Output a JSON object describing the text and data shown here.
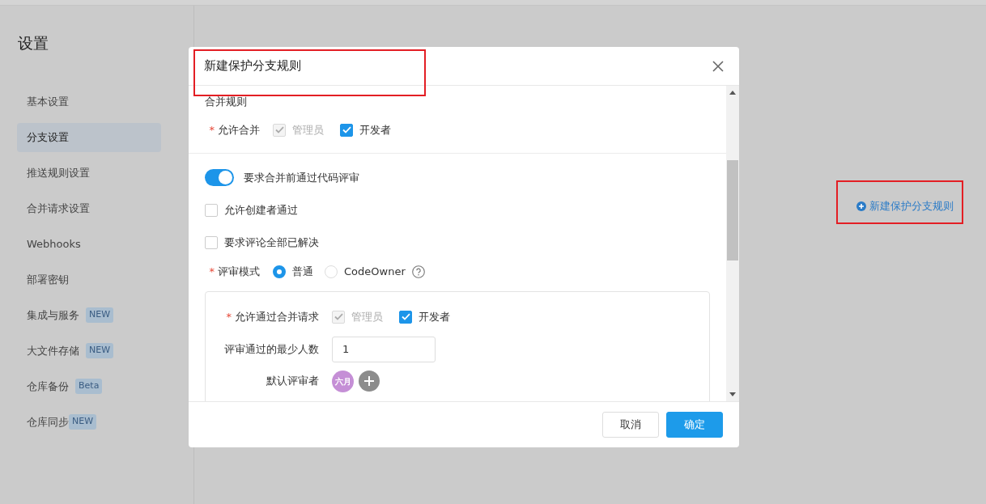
{
  "page": {
    "title": "设置"
  },
  "sidebar": {
    "items": [
      {
        "label": "基本设置",
        "selected": false
      },
      {
        "label": "分支设置",
        "selected": true
      },
      {
        "label": "推送规则设置",
        "selected": false
      },
      {
        "label": "合并请求设置",
        "selected": false
      },
      {
        "label": "Webhooks",
        "selected": false
      },
      {
        "label": "部署密钥",
        "selected": false
      },
      {
        "label": "集成与服务",
        "badge": "NEW",
        "selected": false
      },
      {
        "label": "大文件存储",
        "badge": "NEW",
        "selected": false
      },
      {
        "label": "仓库备份",
        "badge": "Beta",
        "selected": false
      },
      {
        "label": "仓库同步",
        "badge": "NEW",
        "selected": false
      }
    ]
  },
  "new_rule_link": {
    "label": "新建保护分支规则"
  },
  "dialog": {
    "title": "新建保护分支规则",
    "section_title": "合并规则",
    "allow_merge": {
      "label": "允许合并",
      "required_mark": "*",
      "options": [
        {
          "label": "管理员",
          "checked": true,
          "disabled": true
        },
        {
          "label": "开发者",
          "checked": true,
          "disabled": false
        }
      ]
    },
    "require_review": {
      "label": "要求合并前通过代码评审",
      "on": true
    },
    "checkboxes": [
      {
        "label": "允许创建者通过",
        "checked": false
      },
      {
        "label": "要求评论全部已解决",
        "checked": false
      }
    ],
    "review_mode": {
      "label": "评审模式",
      "required_mark": "*",
      "options": [
        {
          "label": "普通",
          "selected": true,
          "help": false
        },
        {
          "label": "CodeOwner",
          "selected": false,
          "help": true
        }
      ]
    },
    "panel": {
      "allow_pass": {
        "label": "允许通过合并请求",
        "required_mark": "*",
        "options": [
          {
            "label": "管理员",
            "checked": true,
            "disabled": true
          },
          {
            "label": "开发者",
            "checked": true,
            "disabled": false
          }
        ]
      },
      "min_reviewers": {
        "label": "评审通过的最少人数",
        "value": "1"
      },
      "default_reviewers": {
        "label": "默认评审者",
        "avatars": [
          {
            "initials": "六月",
            "color": "#c58fd6"
          }
        ]
      }
    },
    "buttons": [
      {
        "label": "取消",
        "kind": "secondary"
      },
      {
        "label": "确定",
        "kind": "primary"
      }
    ]
  }
}
